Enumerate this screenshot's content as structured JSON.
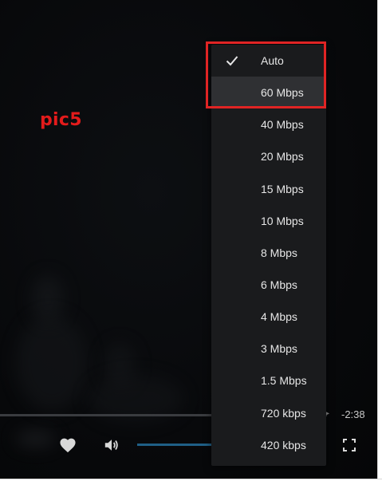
{
  "annotation": {
    "label": "pic5",
    "color": "#e31b1b",
    "highlight_color": "#e02424"
  },
  "player": {
    "time_remaining": "-2:38",
    "progress_color": "#3a3c40",
    "volume_color": "#1f5f86",
    "icons": {
      "like": "heart-icon",
      "volume": "speaker-icon",
      "fullscreen": "fullscreen-icon"
    }
  },
  "quality_menu": {
    "selected": "Auto",
    "hovered": "60 Mbps",
    "check_icon": "checkmark-icon",
    "items": [
      {
        "label": "Auto"
      },
      {
        "label": "60 Mbps"
      },
      {
        "label": "40 Mbps"
      },
      {
        "label": "20 Mbps"
      },
      {
        "label": "15 Mbps"
      },
      {
        "label": "10 Mbps"
      },
      {
        "label": "8 Mbps"
      },
      {
        "label": "6 Mbps"
      },
      {
        "label": "4 Mbps"
      },
      {
        "label": "3 Mbps"
      },
      {
        "label": "1.5 Mbps"
      },
      {
        "label": "720 kbps"
      },
      {
        "label": "420 kbps"
      }
    ]
  }
}
